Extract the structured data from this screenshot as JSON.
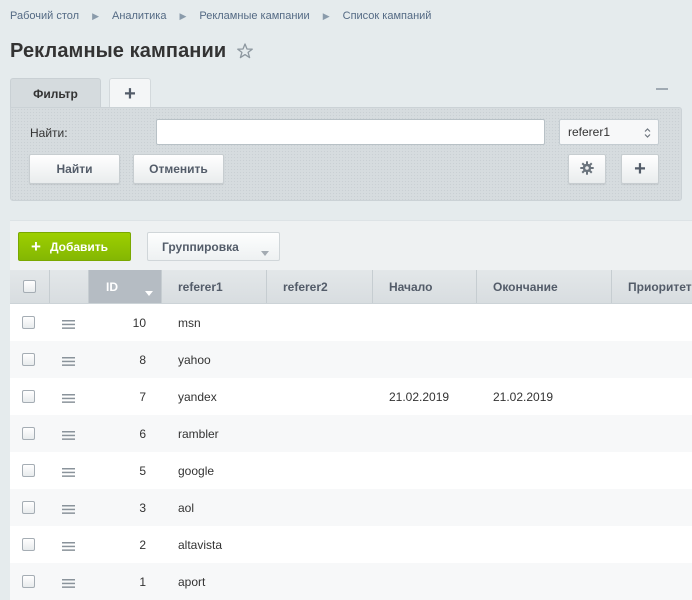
{
  "breadcrumb": [
    "Рабочий стол",
    "Аналитика",
    "Рекламные кампании",
    "Список кампаний"
  ],
  "page": {
    "title": "Рекламные кампании"
  },
  "filter": {
    "tab_label": "Фильтр",
    "add_tab": "+",
    "find_label": "Найти:",
    "search_value": "",
    "field_select": "referer1",
    "find_button": "Найти",
    "cancel_button": "Отменить",
    "plus_button": "+"
  },
  "toolbar": {
    "add_button": "Добавить",
    "add_glyph": "+",
    "group_button": "Группировка"
  },
  "table": {
    "columns": [
      "ID",
      "referer1",
      "referer2",
      "Начало",
      "Окончание",
      "Приоритет"
    ],
    "rows": [
      {
        "id": "10",
        "referer1": "msn",
        "referer2": "",
        "start": "",
        "end": ""
      },
      {
        "id": "8",
        "referer1": "yahoo",
        "referer2": "",
        "start": "",
        "end": ""
      },
      {
        "id": "7",
        "referer1": "yandex",
        "referer2": "",
        "start": "21.02.2019",
        "end": "21.02.2019"
      },
      {
        "id": "6",
        "referer1": "rambler",
        "referer2": "",
        "start": "",
        "end": ""
      },
      {
        "id": "5",
        "referer1": "google",
        "referer2": "",
        "start": "",
        "end": ""
      },
      {
        "id": "3",
        "referer1": "aol",
        "referer2": "",
        "start": "",
        "end": ""
      },
      {
        "id": "2",
        "referer1": "altavista",
        "referer2": "",
        "start": "",
        "end": ""
      },
      {
        "id": "1",
        "referer1": "aport",
        "referer2": "",
        "start": "",
        "end": ""
      }
    ]
  },
  "icons": {
    "breadcrumb_separator": "chevron-right-icon",
    "title_star": "star-icon",
    "collapse": "minus-icon",
    "select_arrows": "updown-icon",
    "settings": "gear-icon",
    "sort": "caret-down-icon",
    "row_menu": "burger-icon"
  },
  "colors": {
    "accent_green": "#8ec400",
    "header_sorted": "#b5bcc3",
    "link": "#546a84"
  }
}
